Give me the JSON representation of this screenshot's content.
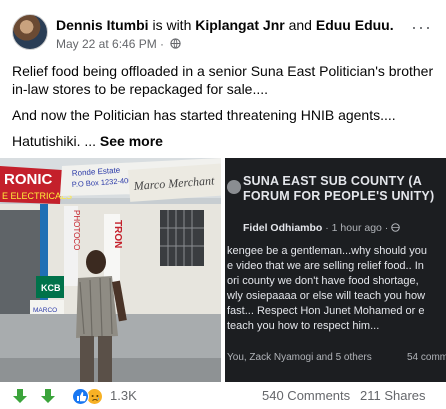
{
  "post": {
    "author": "Dennis Itumbi",
    "with_text": "is with",
    "tag1": "Kiplangat Jnr",
    "and_text": "and",
    "tag2": "Eduu Eduu.",
    "timestamp": "May 22 at 6:46 PM ·",
    "privacy_icon": "globe-icon",
    "more_icon": "more-options-icon",
    "paragraph1": "Relief food being offloaded in a senior Suna East Politician's brother in-law stores to be repackaged for sale....",
    "paragraph2": "And now the Politician has started threatening HNIB agents....",
    "paragraph3": "Hatutishiki. ...",
    "see_more": "See more"
  },
  "photo_left": {
    "sign_red": "RONIC",
    "sign_red2": "E ELECTRICALS",
    "sign_top": "Ronde Estate",
    "sign_top2": "P.O Box 1232-4000 Suna Kenya",
    "sign_marco": "Marco Merchant",
    "vert1": "PHOTOCO",
    "vert2": "TRON",
    "kcb": "KCB",
    "marco_small": "MARCO"
  },
  "photo_right": {
    "group_title": "SUNA EAST SUB COUNTY (A FORUM FOR PEOPLE'S UNITY)",
    "commenter": "Fidel Odhiambo",
    "time": "· 1 hour ago ·",
    "line1": "kengee be a gentleman...why should you",
    "line2": "e video that we are selling relief food.. In",
    "line3": "ori county we don't have food shortage,",
    "line4": "wly osiepaaaa or else will teach you how",
    "line5": "fast... Respect Hon Junet Mohamed or e",
    "line6": "teach you how to respect him...",
    "foot_left": "You, Zack Nyamogi and 5 others",
    "foot_right": "54 comm"
  },
  "footer": {
    "reactions": [
      "down-arrow-icon",
      "down-arrow-icon",
      "like-icon",
      "sad-icon"
    ],
    "reaction_count": "1.3K",
    "comments": "540 Comments",
    "shares": "211 Shares"
  }
}
